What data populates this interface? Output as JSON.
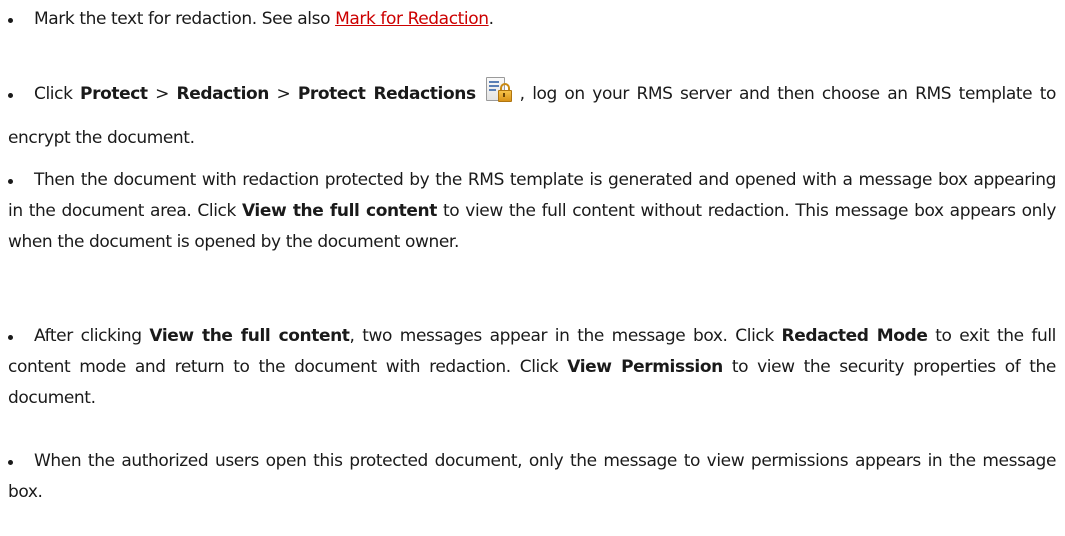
{
  "bullets": [
    {
      "lead": "Mark the text for redaction. See also ",
      "link": "Mark for Redaction",
      "tail": "."
    },
    {
      "part1": "Click ",
      "bold1": "Protect",
      "sep1": " > ",
      "bold2": "Redaction",
      "sep2": " > ",
      "bold3": "Protect Redactions",
      "icon": "protect-redactions-icon",
      "part2": ", log on your RMS server and then choose an RMS template to encrypt the document."
    },
    {
      "part1": "Then the document with redaction protected by the RMS template is generated and opened with a message box appearing in the document area. Click ",
      "bold1": "View the full content",
      "part2": " to view the full content without redaction. This message box appears only when the document is opened by the document owner."
    },
    {
      "part1": "After clicking ",
      "bold1": "View the full content",
      "part2": ", two messages appear in the message box. Click ",
      "bold2": "Redacted Mode",
      "part3": " to exit the full content mode and return to the document with redaction. Click ",
      "bold3": "View Permission",
      "part4": " to view the security properties of the document."
    },
    {
      "text": "When the authorized users open this protected document, only the message to view permissions appears in the message box."
    }
  ],
  "colors": {
    "link": "#cc0000",
    "text": "#1a1a1a"
  }
}
